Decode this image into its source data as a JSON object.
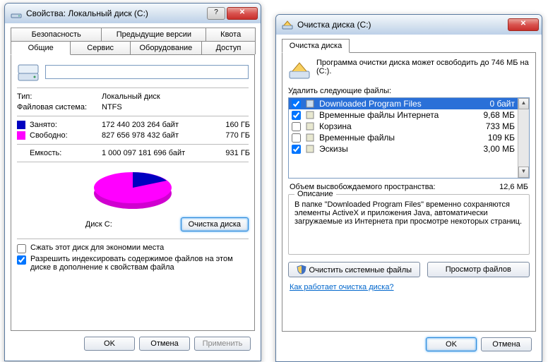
{
  "left": {
    "title": "Свойства: Локальный диск (C:)",
    "tabs_row1": [
      "Безопасность",
      "Предыдущие версии",
      "Квота"
    ],
    "tabs_row2": [
      "Общие",
      "Сервис",
      "Оборудование",
      "Доступ"
    ],
    "type_label": "Тип:",
    "type_value": "Локальный диск",
    "fs_label": "Файловая система:",
    "fs_value": "NTFS",
    "used_label": "Занято:",
    "used_bytes": "172 440 203 264 байт",
    "used_h": "160 ГБ",
    "free_label": "Свободно:",
    "free_bytes": "827 656 978 432 байт",
    "free_h": "770 ГБ",
    "cap_label": "Емкость:",
    "cap_bytes": "1 000 097 181 696 байт",
    "cap_h": "931 ГБ",
    "chart_label": "Диск C:",
    "cleanup_btn": "Очистка диска",
    "compress": "Сжать этот диск для экономии места",
    "index": "Разрешить индексировать содержимое файлов на этом диске в дополнение к свойствам файла",
    "ok": "OK",
    "cancel": "Отмена",
    "apply": "Применить"
  },
  "right": {
    "title": "Очистка диска  (C:)",
    "tab": "Очистка диска",
    "intro": "Программа очистки диска может освободить до 746 МБ на  (C:).",
    "list_label": "Удалить следующие файлы:",
    "files": [
      {
        "checked": true,
        "name": "Downloaded Program Files",
        "size": "0 байт",
        "sel": true
      },
      {
        "checked": true,
        "name": "Временные файлы Интернета",
        "size": "9,68 МБ"
      },
      {
        "checked": false,
        "name": "Корзина",
        "size": "733 МБ"
      },
      {
        "checked": false,
        "name": "Временные файлы",
        "size": "109 КБ"
      },
      {
        "checked": true,
        "name": "Эскизы",
        "size": "3,00 МБ"
      }
    ],
    "sum_label": "Объем высвобождаемого пространства:",
    "sum_value": "12,6 МБ",
    "desc_legend": "Описание",
    "desc_text": "В папке \"Downloaded Program Files\" временно сохраняются элементы ActiveX и приложения Java, автоматически загружаемые из Интернета при просмотре некоторых страниц.",
    "clean_sys": "Очистить системные файлы",
    "view_files": "Просмотр файлов",
    "how_link": "Как работает очистка диска?",
    "ok": "OK",
    "cancel": "Отмена"
  },
  "chart_data": {
    "type": "pie",
    "title": "Диск C:",
    "series": [
      {
        "name": "Занято",
        "value": 160,
        "color": "#0000c0"
      },
      {
        "name": "Свободно",
        "value": 770,
        "color": "#ff00ff"
      }
    ],
    "unit": "ГБ"
  }
}
